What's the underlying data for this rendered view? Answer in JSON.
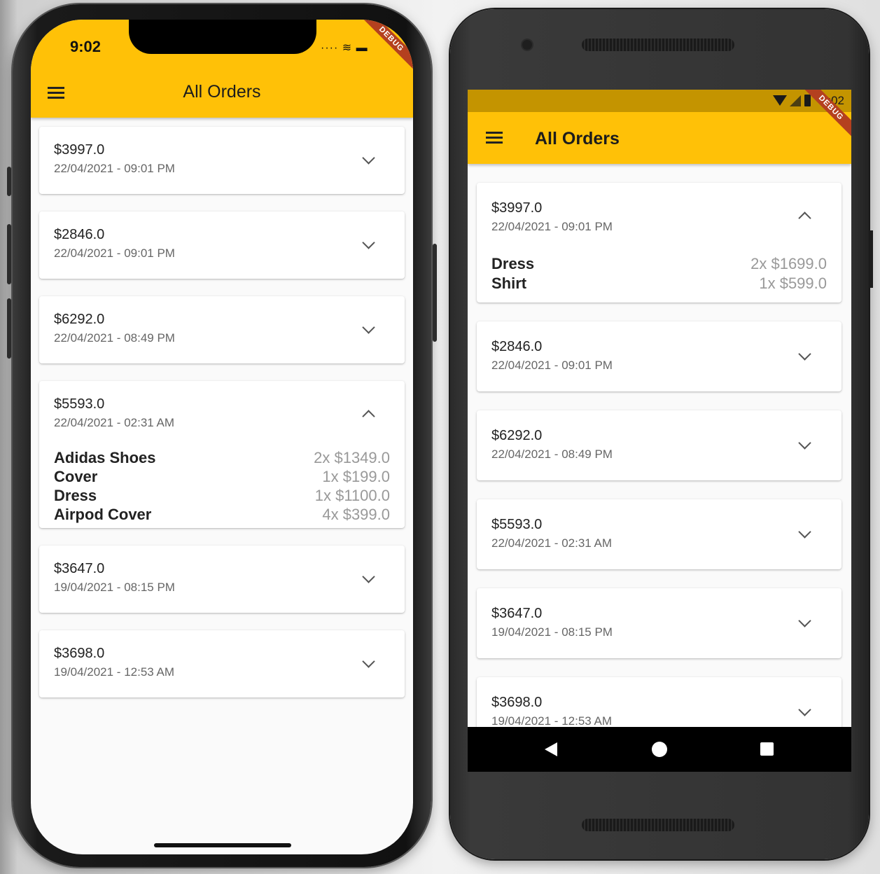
{
  "ios": {
    "status_time": "9:02",
    "status_icons": "···· ≋ ▬",
    "debug_label": "DEBUG",
    "title": "All Orders",
    "orders": [
      {
        "amount": "$3997.0",
        "date": "22/04/2021 - 09:01 PM",
        "expanded": false
      },
      {
        "amount": "$2846.0",
        "date": "22/04/2021 - 09:01 PM",
        "expanded": false
      },
      {
        "amount": "$6292.0",
        "date": "22/04/2021 - 08:49 PM",
        "expanded": false
      },
      {
        "amount": "$5593.0",
        "date": "22/04/2021 - 02:31 AM",
        "expanded": true,
        "items": [
          {
            "name": "Adidas Shoes",
            "qty_price": "2x $1349.0"
          },
          {
            "name": "Cover",
            "qty_price": "1x $199.0"
          },
          {
            "name": "Dress",
            "qty_price": "1x $1100.0"
          },
          {
            "name": "Airpod Cover",
            "qty_price": "4x $399.0"
          }
        ]
      },
      {
        "amount": "$3647.0",
        "date": "19/04/2021 - 08:15 PM",
        "expanded": false
      },
      {
        "amount": "$3698.0",
        "date": "19/04/2021 - 12:53 AM",
        "expanded": false
      }
    ]
  },
  "android": {
    "status_time": "9:02",
    "debug_label": "DEBUG",
    "title": "All Orders",
    "orders": [
      {
        "amount": "$3997.0",
        "date": "22/04/2021 - 09:01 PM",
        "expanded": true,
        "items": [
          {
            "name": "Dress",
            "qty_price": "2x $1699.0"
          },
          {
            "name": "Shirt",
            "qty_price": "1x $599.0"
          }
        ]
      },
      {
        "amount": "$2846.0",
        "date": "22/04/2021 - 09:01 PM",
        "expanded": false
      },
      {
        "amount": "$6292.0",
        "date": "22/04/2021 - 08:49 PM",
        "expanded": false
      },
      {
        "amount": "$5593.0",
        "date": "22/04/2021 - 02:31 AM",
        "expanded": false
      },
      {
        "amount": "$3647.0",
        "date": "19/04/2021 - 08:15 PM",
        "expanded": false
      },
      {
        "amount": "$3698.0",
        "date": "19/04/2021 - 12:53 AM",
        "expanded": false
      }
    ]
  },
  "colors": {
    "accent": "#ffc107",
    "status_bar_dark": "#c49400",
    "debug_banner": "#b4401f"
  }
}
